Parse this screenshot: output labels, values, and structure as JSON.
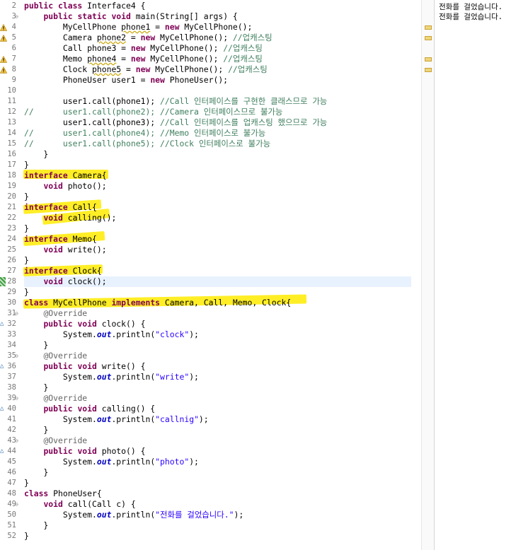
{
  "editor": {
    "lines": [
      {
        "n": "2",
        "html": "<span class='kw'>public class</span> Interface4 {"
      },
      {
        "n": "3",
        "html": "    <span class='kw'>public static void</span> main(String[] args) {",
        "fold": "⊖"
      },
      {
        "n": "4",
        "html": "        MyCellPhone <span class='wv'>phone1</span> = <span class='kw'>new</span> MyCellPhone();",
        "warn": true
      },
      {
        "n": "5",
        "html": "        Camera <span class='wv'>phone2</span> = <span class='kw'>new</span> MyCellPhone(); <span class='cm'>//업캐스팅</span>",
        "warn": true
      },
      {
        "n": "6",
        "html": "        Call phone3 = <span class='kw'>new</span> MyCellPhone(); <span class='cm'>//업캐스팅</span>"
      },
      {
        "n": "7",
        "html": "        Memo <span class='wv'>phone4</span> = <span class='kw'>new</span> MyCellPhone(); <span class='cm'>//업캐스팅</span>",
        "warn": true
      },
      {
        "n": "8",
        "html": "        Clock <span class='wv'>phone5</span> = <span class='kw'>new</span> MyCellPhone(); <span class='cm'>//업캐스팅</span>",
        "warn": true
      },
      {
        "n": "9",
        "html": "        PhoneUser user1 = <span class='kw'>new</span> PhoneUser();"
      },
      {
        "n": "10",
        "html": ""
      },
      {
        "n": "11",
        "html": "        user1.call(phone1); <span class='cm'>//Call 인터페이스를 구현한 클래스므로 가능</span>"
      },
      {
        "n": "12",
        "html": "<span class='cm'>//      user1.call(phone2); //Camera 인터페이스므로 불가능</span>"
      },
      {
        "n": "13",
        "html": "        user1.call(phone3); <span class='cm'>//Call 인터페이스를 업캐스팅 했으므로 가능</span>"
      },
      {
        "n": "14",
        "html": "<span class='cm'>//      user1.call(phone4); //Memo 인터페이스로 불가능</span>"
      },
      {
        "n": "15",
        "html": "<span class='cm'>//      user1.call(phone5); //Clock 인터페이스로 불가능</span>"
      },
      {
        "n": "16",
        "html": "    }"
      },
      {
        "n": "17",
        "html": "}"
      },
      {
        "n": "18",
        "html": "<span class='kw'>interface</span> Camera{"
      },
      {
        "n": "19",
        "html": "    <span class='kw'>void</span> photo();"
      },
      {
        "n": "20",
        "html": "}"
      },
      {
        "n": "21",
        "html": "<span class='kw'>interface</span> Call{"
      },
      {
        "n": "22",
        "html": "    <span class='kw'>void</span> calling();"
      },
      {
        "n": "23",
        "html": "}"
      },
      {
        "n": "24",
        "html": "<span class='kw'>interface</span> Memo{"
      },
      {
        "n": "25",
        "html": "    <span class='kw'>void</span> write();"
      },
      {
        "n": "26",
        "html": "}"
      },
      {
        "n": "27",
        "html": "<span class='kw'>interface</span> Clock{"
      },
      {
        "n": "28",
        "html": "    <span class='kw'>void</span> clock();",
        "current": true
      },
      {
        "n": "29",
        "html": "}"
      },
      {
        "n": "30",
        "html": "<span class='kw'>class</span> MyCellPhone <span class='kw'>implements</span> Camera, Call, Memo, Clock{"
      },
      {
        "n": "31",
        "html": "    <span class='an'>@Override</span>",
        "fold": "⊖"
      },
      {
        "n": "32",
        "html": "    <span class='kw'>public void</span> clock() {",
        "over": true
      },
      {
        "n": "33",
        "html": "        System.<span class='st'>out</span>.println(<span class='str'>\"clock\"</span>);"
      },
      {
        "n": "34",
        "html": "    }"
      },
      {
        "n": "35",
        "html": "    <span class='an'>@Override</span>",
        "fold": "⊖"
      },
      {
        "n": "36",
        "html": "    <span class='kw'>public void</span> write() {",
        "over": true
      },
      {
        "n": "37",
        "html": "        System.<span class='st'>out</span>.println(<span class='str'>\"write\"</span>);"
      },
      {
        "n": "38",
        "html": "    }"
      },
      {
        "n": "39",
        "html": "    <span class='an'>@Override</span>",
        "fold": "⊖"
      },
      {
        "n": "40",
        "html": "    <span class='kw'>public void</span> calling() {",
        "over": true
      },
      {
        "n": "41",
        "html": "        System.<span class='st'>out</span>.println(<span class='str'>\"callnig\"</span>);"
      },
      {
        "n": "42",
        "html": "    }"
      },
      {
        "n": "43",
        "html": "    <span class='an'>@Override</span>",
        "fold": "⊖"
      },
      {
        "n": "44",
        "html": "    <span class='kw'>public void</span> photo() {",
        "over": true
      },
      {
        "n": "45",
        "html": "        System.<span class='st'>out</span>.println(<span class='str'>\"photo\"</span>);"
      },
      {
        "n": "46",
        "html": "    }"
      },
      {
        "n": "47",
        "html": "}"
      },
      {
        "n": "48",
        "html": "<span class='kw'>class</span> PhoneUser{"
      },
      {
        "n": "49",
        "html": "    <span class='kw'>void</span> call(Call c) {",
        "fold": "⊖"
      },
      {
        "n": "50",
        "html": "        System.<span class='st'>out</span>.println(<span class='str'>\"전화를 걸었습니다.\"</span>);"
      },
      {
        "n": "51",
        "html": "    }"
      },
      {
        "n": "52",
        "html": "}"
      }
    ]
  },
  "console": {
    "lines": [
      "전화를 걸었습니다.",
      "전화를 걸었습니다."
    ]
  },
  "colors": {
    "keyword": "#7f0055",
    "comment": "#3f7f5f",
    "string": "#2a00ff",
    "annotation": "#646464",
    "static_field": "#0000c0",
    "highlighter": "#ffeb00",
    "current_line": "#e8f2fe"
  },
  "icons": {
    "warning": "warning-icon",
    "fold": "fold-collapse-icon",
    "override": "override-marker-icon"
  }
}
